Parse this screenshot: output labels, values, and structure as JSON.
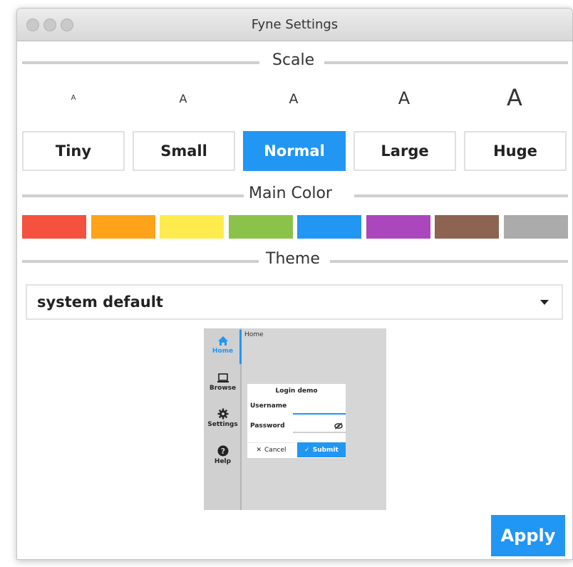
{
  "window": {
    "title": "Fyne Settings"
  },
  "sections": {
    "scale": "Scale",
    "main_color": "Main Color",
    "theme": "Theme"
  },
  "scale": {
    "sample_glyph": "A",
    "options": [
      {
        "label": "Tiny",
        "selected": false
      },
      {
        "label": "Small",
        "selected": false
      },
      {
        "label": "Normal",
        "selected": true
      },
      {
        "label": "Large",
        "selected": false
      },
      {
        "label": "Huge",
        "selected": false
      }
    ]
  },
  "colors": {
    "swatches": [
      "#f5513f",
      "#ffa31a",
      "#ffeb4d",
      "#8bc34a",
      "#2196f3",
      "#ab47bc",
      "#8d6352",
      "#ababab"
    ],
    "accent": "#2196f3"
  },
  "theme": {
    "selected": "system default"
  },
  "preview": {
    "nav": [
      {
        "label": "Home",
        "icon": "home-icon",
        "active": true
      },
      {
        "label": "Browse",
        "icon": "laptop-icon",
        "active": false
      },
      {
        "label": "Settings",
        "icon": "gear-icon",
        "active": false
      },
      {
        "label": "Help",
        "icon": "help-icon",
        "active": false
      }
    ],
    "page_title": "Home",
    "card_title": "Login demo",
    "username_label": "Username",
    "password_label": "Password",
    "cancel_label": "Cancel",
    "submit_label": "Submit"
  },
  "apply_label": "Apply"
}
